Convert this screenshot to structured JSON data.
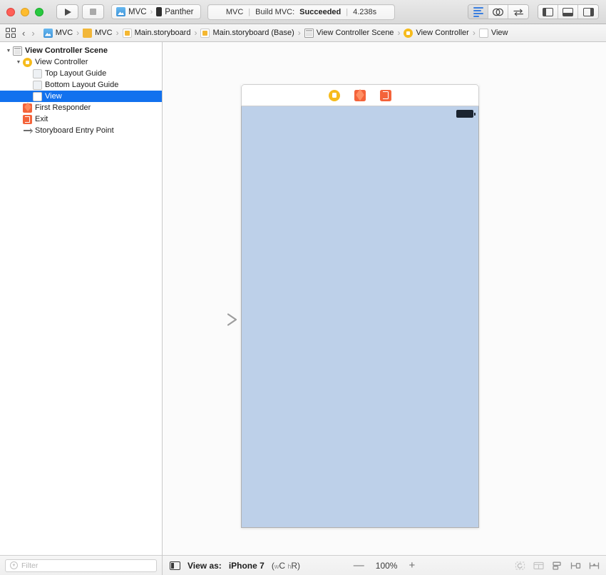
{
  "window": {
    "traffic_lights": [
      "close",
      "minimize",
      "zoom"
    ]
  },
  "toolbar": {
    "run_label": "Run",
    "stop_label": "Stop",
    "scheme_name": "MVC",
    "scheme_separator": "›",
    "destination": "Panther",
    "status": {
      "project": "MVC",
      "sep": "|",
      "activity_prefix": "Build MVC:",
      "activity_result": "Succeeded",
      "duration": "4.238s"
    },
    "editor_modes": [
      {
        "name": "standard-editor",
        "label": "Standard Editor",
        "active": true
      },
      {
        "name": "assistant-editor",
        "label": "Assistant Editor",
        "active": false
      },
      {
        "name": "version-editor",
        "label": "Version Editor",
        "active": false
      }
    ],
    "view_toggles": [
      {
        "name": "navigator-toggle",
        "label": "Hide or show the Navigator"
      },
      {
        "name": "debug-area-toggle",
        "label": "Hide or show the Debug area"
      },
      {
        "name": "utilities-toggle",
        "label": "Hide or show the Utilities"
      }
    ]
  },
  "breadcrumb": {
    "back_label": "‹",
    "forward_label": "›",
    "items": [
      {
        "label": "MVC",
        "icon": "xcodeproj-icon"
      },
      {
        "label": "MVC",
        "icon": "folder-icon"
      },
      {
        "label": "Main.storyboard",
        "icon": "storyboard-icon"
      },
      {
        "label": "Main.storyboard (Base)",
        "icon": "storyboard-icon"
      },
      {
        "label": "View Controller Scene",
        "icon": "scene-icon"
      },
      {
        "label": "View Controller",
        "icon": "view-controller-icon"
      },
      {
        "label": "View",
        "icon": "view-icon"
      }
    ],
    "separator": "›"
  },
  "outline": {
    "rows": [
      {
        "label": "View Controller Scene",
        "icon": "scene-icon",
        "indent": 0,
        "twisty": "▼",
        "selected": false,
        "bold": true
      },
      {
        "label": "View Controller",
        "icon": "view-controller-icon",
        "indent": 1,
        "twisty": "▼",
        "selected": false,
        "bold": false
      },
      {
        "label": "Top Layout Guide",
        "icon": "layout-guide-icon",
        "indent": 2,
        "twisty": "",
        "selected": false,
        "bold": false
      },
      {
        "label": "Bottom Layout Guide",
        "icon": "layout-guide-icon",
        "indent": 2,
        "twisty": "",
        "selected": false,
        "bold": false
      },
      {
        "label": "View",
        "icon": "view-icon",
        "indent": 2,
        "twisty": "",
        "selected": true,
        "bold": false
      },
      {
        "label": "First Responder",
        "icon": "first-responder-icon",
        "indent": 1,
        "twisty": "",
        "selected": false,
        "bold": false
      },
      {
        "label": "Exit",
        "icon": "exit-icon",
        "indent": 1,
        "twisty": "",
        "selected": false,
        "bold": false
      },
      {
        "label": "Storyboard Entry Point",
        "icon": "entry-point-icon",
        "indent": 1,
        "twisty": "",
        "selected": false,
        "bold": false
      }
    ],
    "filter_placeholder": "Filter"
  },
  "canvas": {
    "scene_dock": [
      {
        "name": "view-controller-dock-icon",
        "label": "View Controller"
      },
      {
        "name": "first-responder-dock-icon",
        "label": "First Responder"
      },
      {
        "name": "exit-dock-icon",
        "label": "Exit"
      }
    ],
    "view_background_color": "#bdd0e9",
    "status_bar": {
      "battery": "battery-icon"
    },
    "entry_point_arrow": "storyboard-entry-point-arrow"
  },
  "canvas_bar": {
    "view_as_label": "View as:",
    "device": "iPhone 7",
    "size_class_open": "(",
    "size_class_w_sub": "w",
    "size_class_w": "C",
    "size_class_h_sub": "h",
    "size_class_h": "R",
    "size_class_close": ")",
    "zoom_out": "—",
    "zoom_level": "100%",
    "zoom_in": "+",
    "autolayout_buttons": [
      {
        "name": "update-frames-button",
        "label": "Update Frames"
      },
      {
        "name": "embed-in-button",
        "label": "Embed In"
      },
      {
        "name": "align-button",
        "label": "Align"
      },
      {
        "name": "add-new-constraints-button",
        "label": "Add New Constraints"
      },
      {
        "name": "resolve-auto-layout-issues-button",
        "label": "Resolve Auto Layout Issues"
      }
    ]
  }
}
